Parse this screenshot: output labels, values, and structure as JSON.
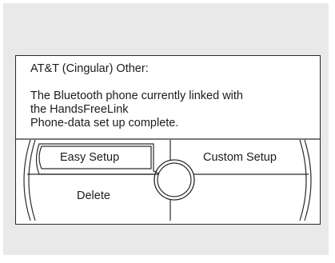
{
  "message": {
    "title": "AT&T (Cingular) Other:",
    "line1": "The Bluetooth phone currently linked with",
    "line2": "the HandsFreeLink",
    "line3": "Phone-data set up complete."
  },
  "buttons": {
    "easy_setup": "Easy Setup",
    "custom_setup": "Custom Setup",
    "delete": "Delete"
  },
  "selected_button": "Easy Setup"
}
